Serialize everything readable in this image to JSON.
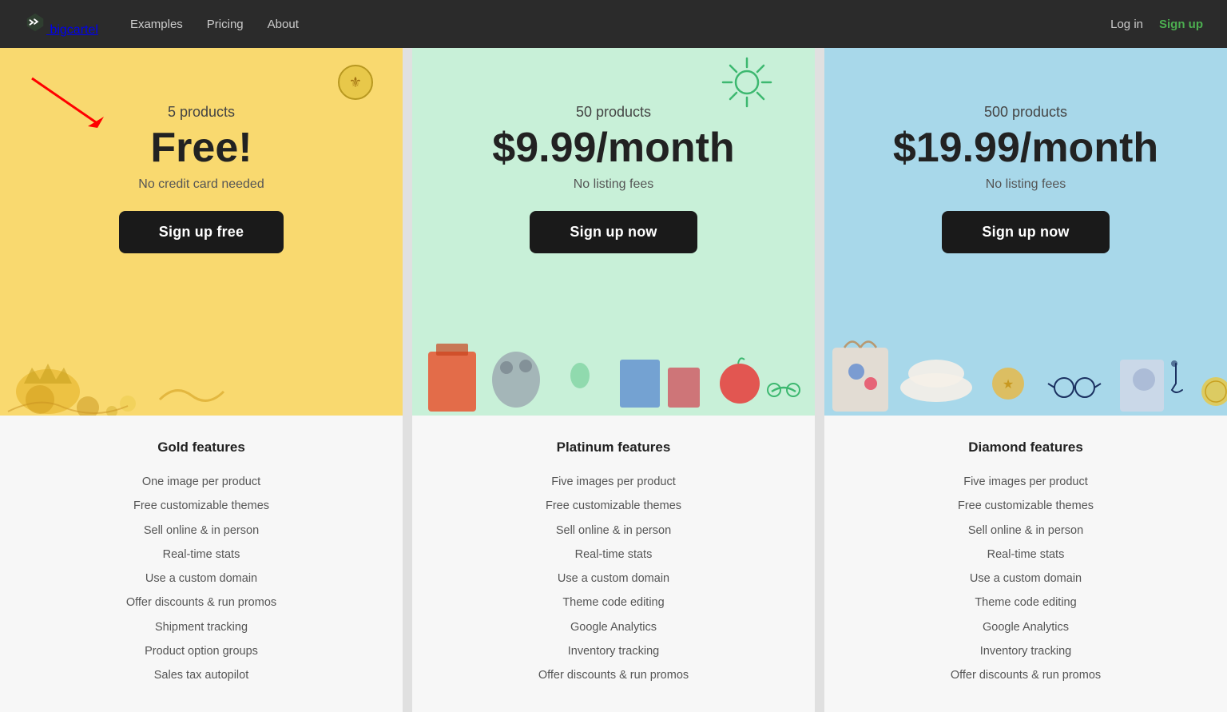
{
  "nav": {
    "brand": "bigcartel",
    "links": [
      {
        "label": "Examples",
        "href": "#"
      },
      {
        "label": "Pricing",
        "href": "#"
      },
      {
        "label": "About",
        "href": "#"
      }
    ],
    "login_label": "Log in",
    "signup_label": "Sign up"
  },
  "plans": [
    {
      "id": "gold",
      "tier": "Gold",
      "theme": "gold",
      "product_count": "5 products",
      "price": "Free!",
      "sublabel": "No credit card needed",
      "cta_label": "Sign up free",
      "features_title": "Gold features",
      "features": [
        "One image per product",
        "Free customizable themes",
        "Sell online & in person",
        "Real-time stats",
        "Use a custom domain",
        "Offer discounts & run promos",
        "Shipment tracking",
        "Product option groups",
        "Sales tax autopilot"
      ]
    },
    {
      "id": "platinum",
      "tier": "Platinum",
      "theme": "platinum",
      "product_count": "50 products",
      "price": "$9.99/month",
      "sublabel": "No listing fees",
      "cta_label": "Sign up now",
      "features_title": "Platinum features",
      "features": [
        "Five images per product",
        "Free customizable themes",
        "Sell online & in person",
        "Real-time stats",
        "Use a custom domain",
        "Theme code editing",
        "Google Analytics",
        "Inventory tracking",
        "Offer discounts & run promos"
      ]
    },
    {
      "id": "diamond",
      "tier": "Diamond",
      "theme": "diamond",
      "product_count": "500 products",
      "price": "$19.99/month",
      "sublabel": "No listing fees",
      "cta_label": "Sign up now",
      "features_title": "Diamond features",
      "features": [
        "Five images per product",
        "Free customizable themes",
        "Sell online & in person",
        "Real-time stats",
        "Use a custom domain",
        "Theme code editing",
        "Google Analytics",
        "Inventory tracking",
        "Offer discounts & run promos"
      ]
    }
  ]
}
